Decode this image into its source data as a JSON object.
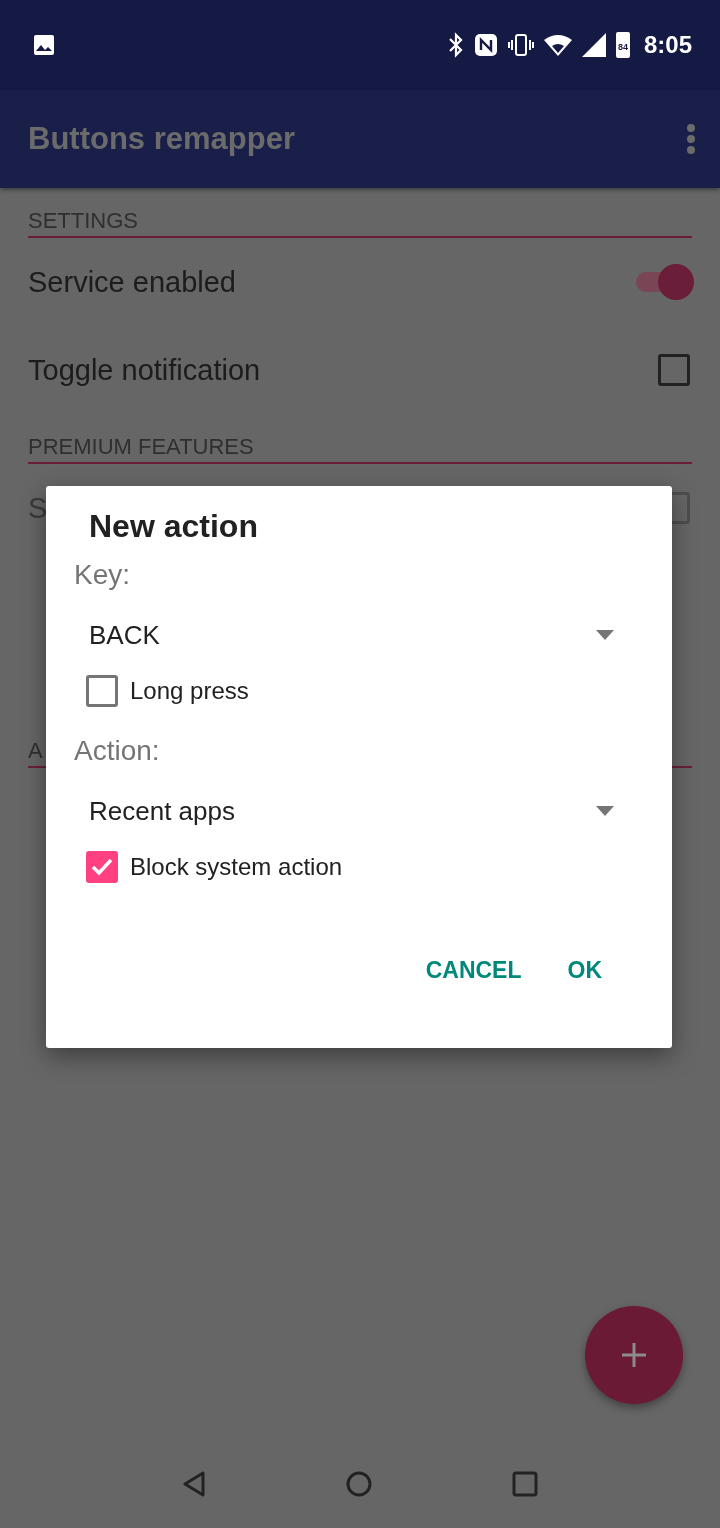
{
  "status_bar": {
    "battery": "84",
    "time": "8:05"
  },
  "app_bar": {
    "title": "Buttons remapper"
  },
  "sections": [
    {
      "header": "SETTINGS",
      "items": [
        {
          "kind": "switch",
          "label": "Service enabled",
          "on": true
        },
        {
          "kind": "checkbox",
          "label": "Toggle notification",
          "checked": false
        }
      ]
    },
    {
      "header": "PREMIUM FEATURES",
      "items": [
        {
          "kind": "checkbox",
          "label": "S",
          "disabled": true
        }
      ]
    },
    {
      "header": "A"
    }
  ],
  "dialog": {
    "title": "New action",
    "fields": [
      {
        "label": "Key:",
        "value": "BACK",
        "option": {
          "label": "Long press",
          "checked": false
        }
      },
      {
        "label": "Action:",
        "value": "Recent apps",
        "option": {
          "label": "Block system action",
          "checked": true
        }
      }
    ],
    "buttons": [
      "CANCEL",
      "OK"
    ]
  }
}
